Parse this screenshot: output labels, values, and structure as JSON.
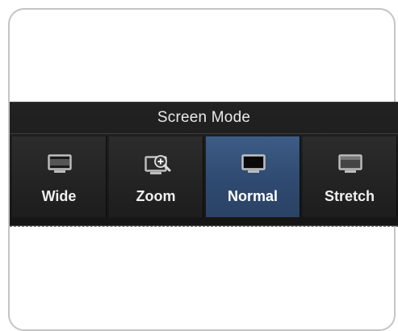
{
  "menu": {
    "title": "Screen Mode",
    "options": [
      {
        "label": "Wide",
        "icon": "monitor-wide-icon",
        "selected": false
      },
      {
        "label": "Zoom",
        "icon": "monitor-zoom-icon",
        "selected": false
      },
      {
        "label": "Normal",
        "icon": "monitor-normal-icon",
        "selected": true
      },
      {
        "label": "Stretch",
        "icon": "monitor-stretch-icon",
        "selected": false
      }
    ]
  },
  "colors": {
    "menu_background": "#1a1a1a",
    "selected_background": "#34527a",
    "text": "#f0f0f0",
    "frame_border": "#c4c4c4"
  }
}
